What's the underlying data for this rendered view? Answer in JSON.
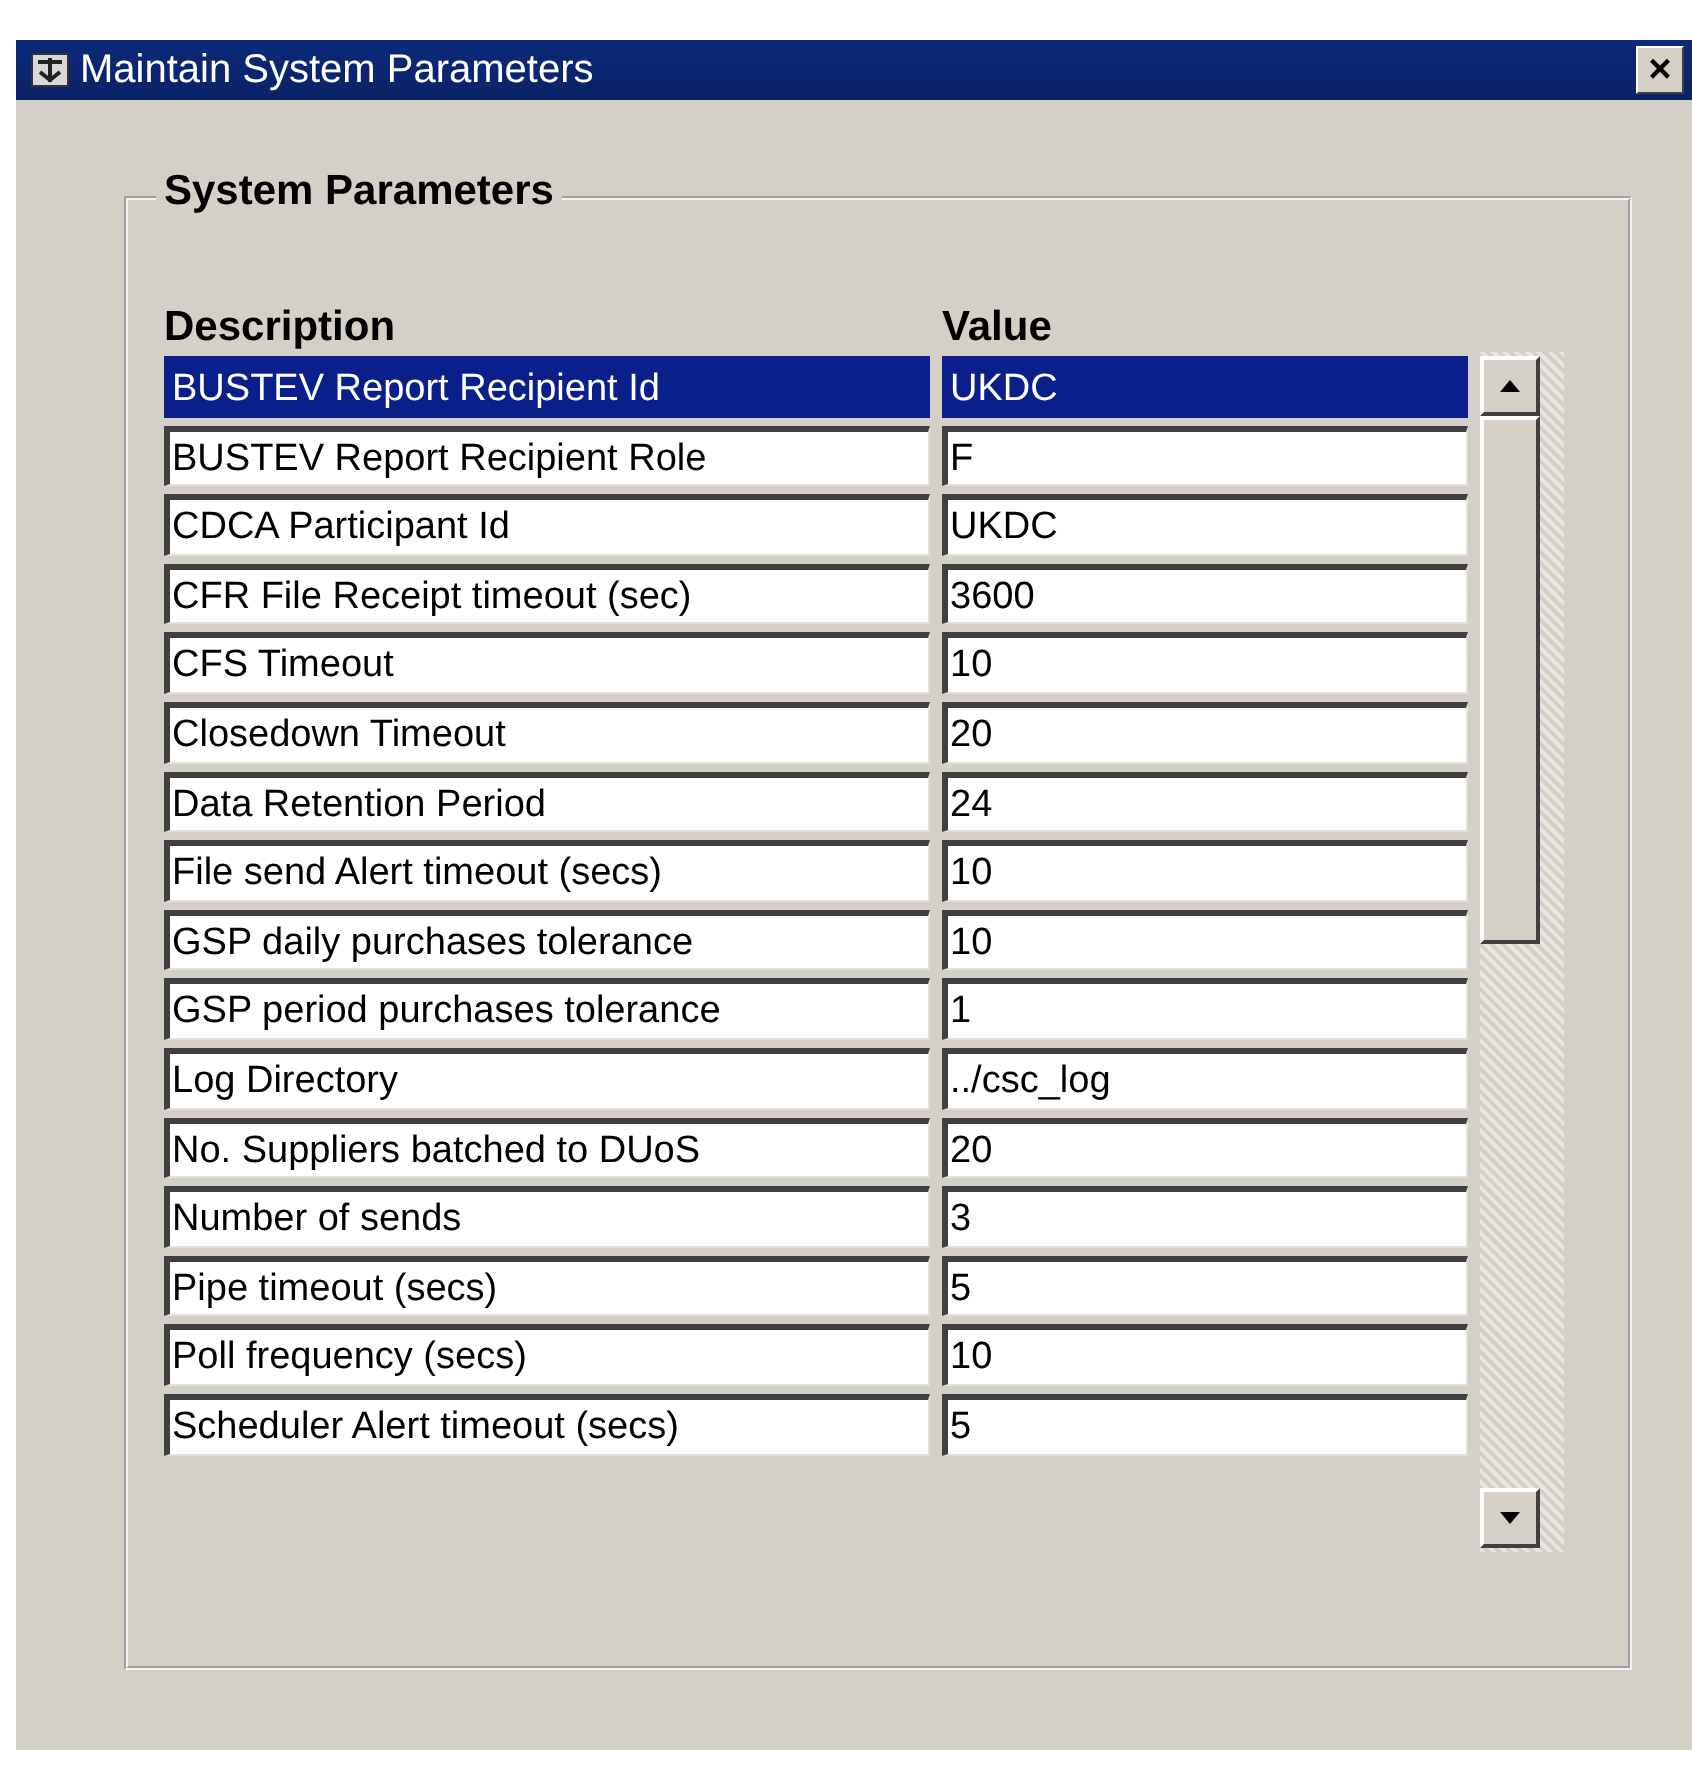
{
  "window": {
    "title": "Maintain System Parameters",
    "close_button": "×"
  },
  "frame": {
    "title": "System Parameters"
  },
  "table": {
    "columns": [
      "Description",
      "Value"
    ],
    "rows": [
      {
        "description": "BUSTEV Report Recipient Id",
        "value": "UKDC",
        "selected": true
      },
      {
        "description": "BUSTEV Report Recipient Role",
        "value": "F",
        "selected": false
      },
      {
        "description": "CDCA Participant Id",
        "value": "UKDC",
        "selected": false
      },
      {
        "description": "CFR File Receipt timeout (sec)",
        "value": "3600",
        "selected": false
      },
      {
        "description": "CFS Timeout",
        "value": "10",
        "selected": false
      },
      {
        "description": "Closedown Timeout",
        "value": "20",
        "selected": false
      },
      {
        "description": "Data Retention Period",
        "value": "24",
        "selected": false
      },
      {
        "description": "File send Alert timeout (secs)",
        "value": "10",
        "selected": false
      },
      {
        "description": "GSP daily purchases tolerance",
        "value": "10",
        "selected": false
      },
      {
        "description": "GSP period purchases tolerance",
        "value": "1",
        "selected": false
      },
      {
        "description": "Log Directory",
        "value": "../csc_log",
        "selected": false
      },
      {
        "description": "No. Suppliers batched to DUoS",
        "value": "20",
        "selected": false
      },
      {
        "description": "Number of sends",
        "value": "3",
        "selected": false
      },
      {
        "description": "Pipe timeout (secs)",
        "value": "5",
        "selected": false
      },
      {
        "description": "Poll frequency (secs)",
        "value": "10",
        "selected": false
      },
      {
        "description": "Scheduler Alert timeout (secs)",
        "value": "5",
        "selected": false
      }
    ]
  }
}
